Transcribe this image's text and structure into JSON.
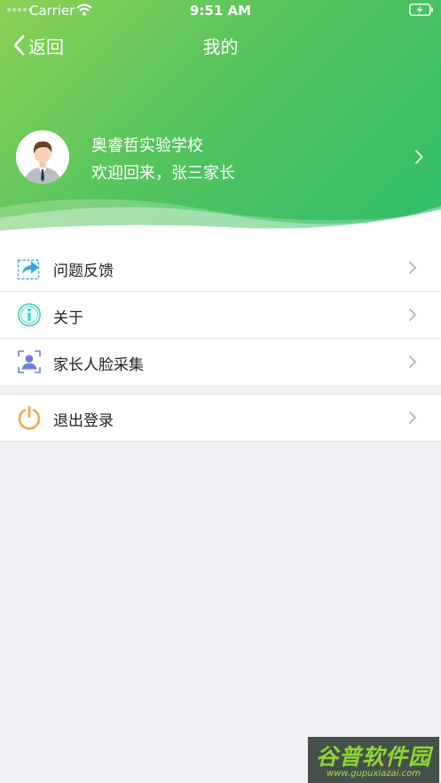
{
  "status_bar": {
    "carrier": "Carrier",
    "time": "9:51 AM"
  },
  "nav": {
    "back_label": "返回",
    "title": "我的"
  },
  "profile": {
    "school": "奥睿哲实验学校",
    "welcome": "欢迎回来，张三家长"
  },
  "menu_group1": [
    {
      "label": "问题反馈",
      "icon": "feedback-share-icon"
    },
    {
      "label": "关于",
      "icon": "info-icon"
    },
    {
      "label": "家长人脸采集",
      "icon": "face-capture-icon"
    }
  ],
  "menu_group2": [
    {
      "label": "退出登录",
      "icon": "power-icon"
    }
  ],
  "watermark": {
    "title": "谷普软件园",
    "url": "www.gupuxiazai.com"
  },
  "colors": {
    "header_gradient_start": "#8bd155",
    "header_gradient_end": "#2ebd6b",
    "page_background": "#efeff4",
    "power_icon": "#f7a24a",
    "info_icon": "#3fd0c0",
    "feedback_icon": "#36a7e6",
    "face_icon": "#6f7de0"
  }
}
